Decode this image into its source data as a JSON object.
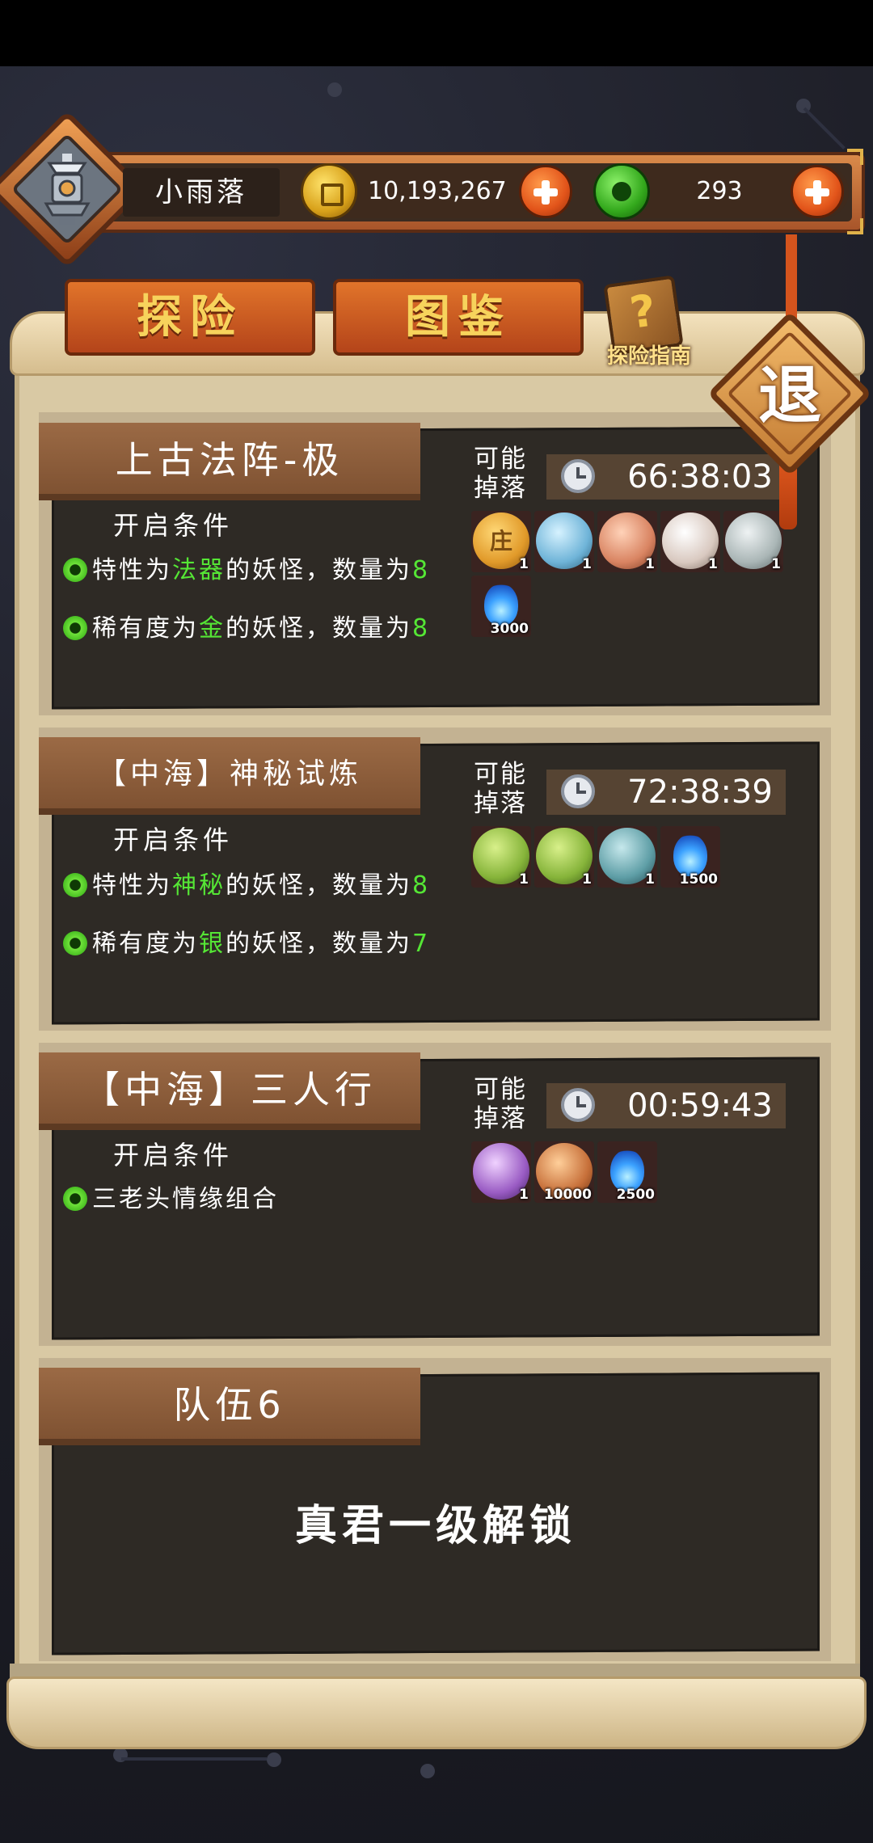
{
  "player": {
    "name": "小雨落"
  },
  "currency": {
    "gold": "10,193,267",
    "jade": "293"
  },
  "tabs": {
    "explore": "探险",
    "atlas": "图鉴"
  },
  "guide": {
    "label": "探险指南"
  },
  "exit": {
    "label": "退"
  },
  "missions": [
    {
      "title": "上古法阵-极",
      "condition_header": "开启条件",
      "drop_label": "可能掉落",
      "timer": "66:38:03",
      "conditions": [
        {
          "prefix": "特性为",
          "highlight": "法器",
          "suffix": "的妖怪，数量为",
          "count": "8"
        },
        {
          "prefix": "稀有度为",
          "highlight": "金",
          "suffix": "的妖怪，数量为",
          "count": "8"
        }
      ],
      "drops": [
        {
          "icon": "gold-seal-orb-icon",
          "qty": "1",
          "glyph": "庄"
        },
        {
          "icon": "silver-coins-orb-icon",
          "qty": "1"
        },
        {
          "icon": "money-bag-orb-icon",
          "qty": "1"
        },
        {
          "icon": "scroll-card-orb-icon",
          "qty": "1"
        },
        {
          "icon": "dice-orb-icon",
          "qty": "1"
        },
        {
          "icon": "blue-flame-icon",
          "qty": "3000"
        }
      ]
    },
    {
      "title": "【中海】神秘试炼",
      "condition_header": "开启条件",
      "drop_label": "可能掉落",
      "timer": "72:38:39",
      "conditions": [
        {
          "prefix": "特性为",
          "highlight": "神秘",
          "suffix": "的妖怪，数量为",
          "count": "8"
        },
        {
          "prefix": "稀有度为",
          "highlight": "银",
          "suffix": "的妖怪，数量为",
          "count": "7"
        }
      ],
      "drops": [
        {
          "icon": "green-clover-orb-icon",
          "qty": "1"
        },
        {
          "icon": "green-clover-orb-icon",
          "qty": "1"
        },
        {
          "icon": "teal-house-orb-icon",
          "qty": "1"
        },
        {
          "icon": "blue-flame-icon",
          "qty": "1500"
        }
      ]
    },
    {
      "title": "【中海】三人行",
      "condition_header": "开启条件",
      "drop_label": "可能掉落",
      "timer": "00:59:43",
      "conditions": [
        {
          "text": "三老头情缘组合"
        }
      ],
      "drops": [
        {
          "icon": "purple-hourglass-orb-icon",
          "qty": "1"
        },
        {
          "icon": "gold-bag-icon",
          "qty": "10000"
        },
        {
          "icon": "blue-flame-icon",
          "qty": "2500"
        }
      ]
    }
  ],
  "team6": {
    "title": "队伍6",
    "locked_text": "真君一级解锁"
  },
  "colors": {
    "highlight": "#55e635",
    "tab_text": "#f7d35c",
    "card_bg": "#2e2a25",
    "title_bg": "#8b5c3a"
  }
}
